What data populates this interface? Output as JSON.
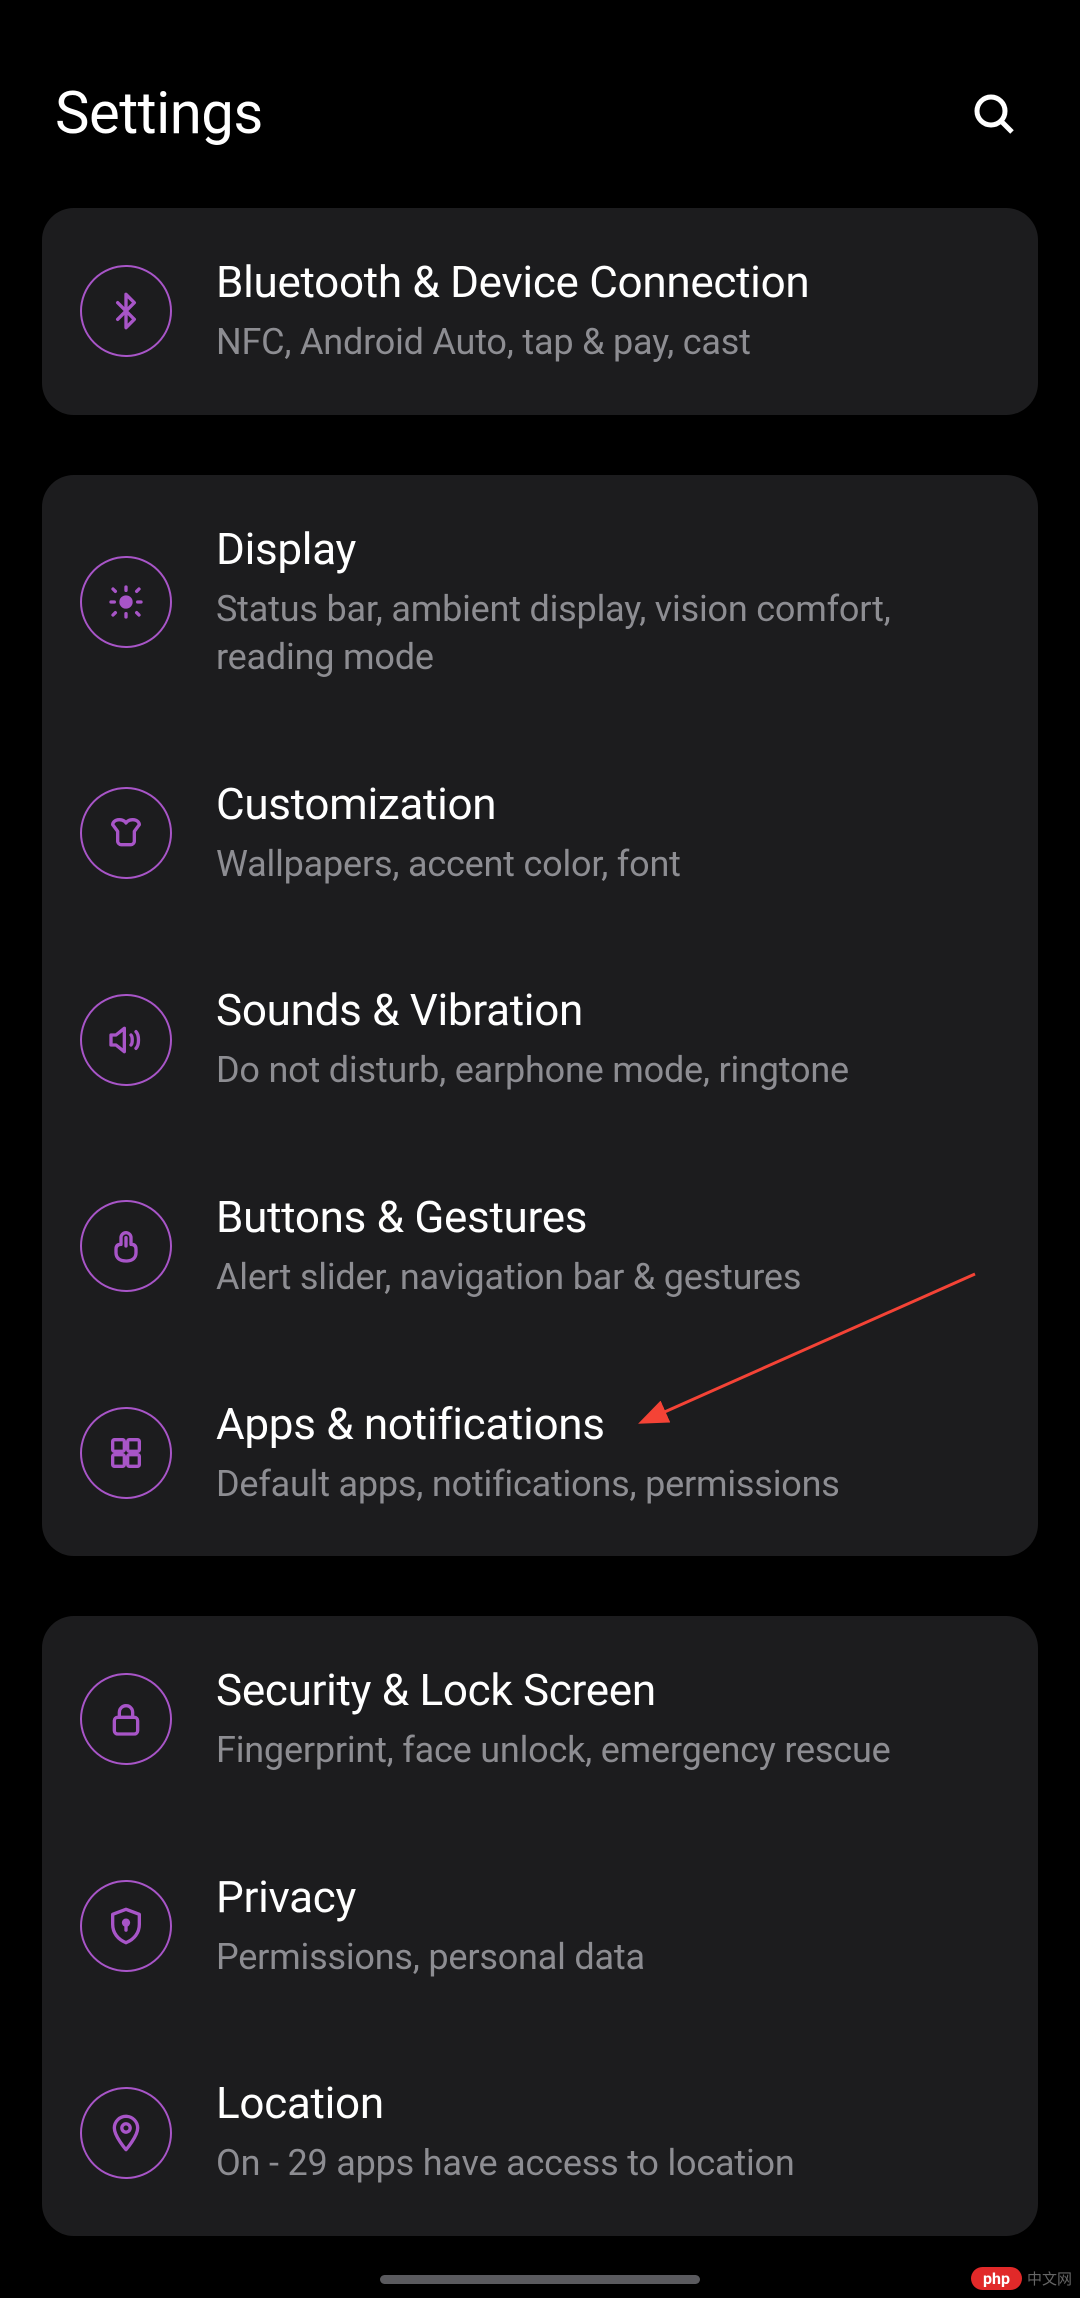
{
  "header": {
    "title": "Settings"
  },
  "groups": [
    {
      "items": [
        {
          "icon": "bluetooth",
          "title": "Bluetooth & Device Connection",
          "subtitle": "NFC, Android Auto, tap & pay, cast"
        }
      ]
    },
    {
      "items": [
        {
          "icon": "display",
          "title": "Display",
          "subtitle": "Status bar, ambient display, vision comfort, reading mode"
        },
        {
          "icon": "customization",
          "title": "Customization",
          "subtitle": "Wallpapers, accent color, font"
        },
        {
          "icon": "sounds",
          "title": "Sounds & Vibration",
          "subtitle": "Do not disturb, earphone mode, ringtone"
        },
        {
          "icon": "buttons",
          "title": "Buttons & Gestures",
          "subtitle": "Alert slider, navigation bar & gestures"
        },
        {
          "icon": "apps",
          "title": "Apps & notifications",
          "subtitle": "Default apps, notifications, permissions"
        }
      ]
    },
    {
      "items": [
        {
          "icon": "security",
          "title": "Security & Lock Screen",
          "subtitle": "Fingerprint, face unlock, emergency rescue"
        },
        {
          "icon": "privacy",
          "title": "Privacy",
          "subtitle": "Permissions, personal data"
        },
        {
          "icon": "location",
          "title": "Location",
          "subtitle": "On - 29 apps have access to location"
        }
      ]
    }
  ],
  "watermark": {
    "badge": "php",
    "text": "中文网"
  }
}
